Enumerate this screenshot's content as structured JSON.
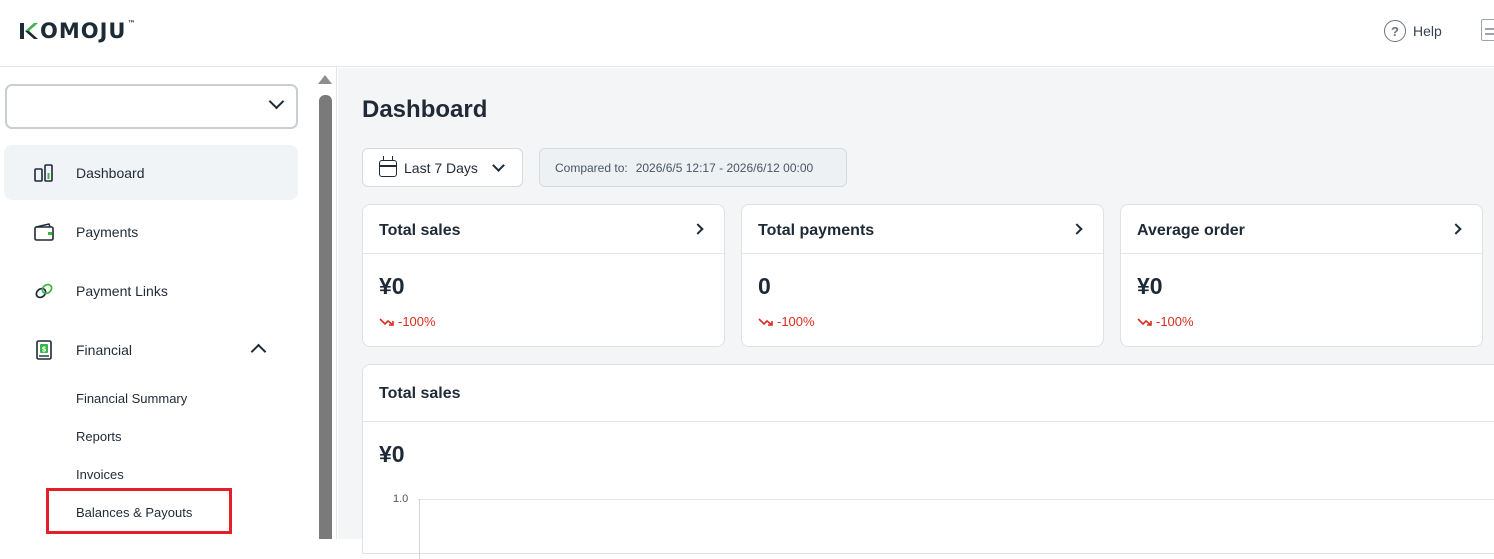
{
  "header": {
    "logo_text": "KOMOJU",
    "logo_tm": "™",
    "help_label": "Help"
  },
  "sidebar": {
    "account_select_value": "",
    "items": [
      {
        "label": "Dashboard",
        "icon": "dashboard-icon",
        "active": true
      },
      {
        "label": "Payments",
        "icon": "wallet-icon"
      },
      {
        "label": "Payment Links",
        "icon": "link-icon"
      },
      {
        "label": "Financial",
        "icon": "financial-doc-icon",
        "expanded": true
      }
    ],
    "financial_sub_items": [
      "Financial Summary",
      "Reports",
      "Invoices",
      "Balances & Payouts"
    ]
  },
  "main": {
    "title": "Dashboard",
    "date_range": "Last 7 Days",
    "compare_label": "Compared to:",
    "compare_range": "2026/6/5 12:17 - 2026/6/12 00:00",
    "cards": [
      {
        "title": "Total sales",
        "value": "¥0",
        "delta": "-100%"
      },
      {
        "title": "Total payments",
        "value": "0",
        "delta": "-100%"
      },
      {
        "title": "Average order",
        "value": "¥0",
        "delta": "-100%"
      }
    ],
    "chart_card": {
      "title": "Total sales",
      "value": "¥0",
      "y_tick": "1.0"
    }
  },
  "colors": {
    "logo_accent": "#3bb54a",
    "negative": "#d92d20",
    "highlight": "#e2202b",
    "main_bg": "#f3f5f7"
  }
}
